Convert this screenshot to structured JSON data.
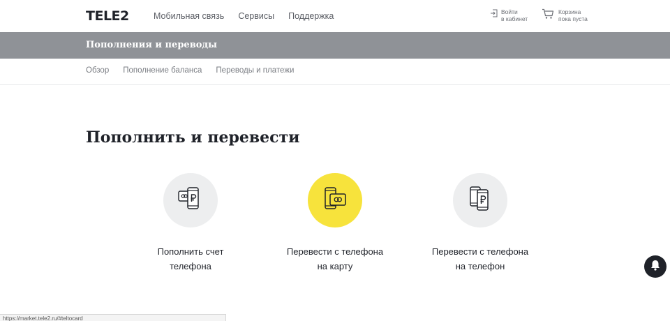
{
  "header": {
    "logo": "TELE2",
    "nav": [
      "Мобильная связь",
      "Сервисы",
      "Поддержка"
    ],
    "login": {
      "line1": "Войти",
      "line2": "в кабинет",
      "icon": "login-icon"
    },
    "cart": {
      "line1": "Корзина",
      "line2": "пока пуста",
      "icon": "cart-icon"
    }
  },
  "band": {
    "title": "Пополнения и переводы"
  },
  "subnav": [
    "Обзор",
    "Пополнение баланса",
    "Переводы и платежи"
  ],
  "main": {
    "heading": "Пополнить и перевести",
    "cards": [
      {
        "line1": "Пополнить счет",
        "line2": "телефона",
        "icon": "phone-card-ruble-icon",
        "circle_color": "#edeeef"
      },
      {
        "line1": "Перевести с телефона",
        "line2": "на карту",
        "icon": "phone-to-card-icon",
        "circle_color": "#f7e33c"
      },
      {
        "line1": "Перевести с телефона",
        "line2": "на телефон",
        "icon": "phone-to-phone-icon",
        "circle_color": "#edeeef"
      }
    ]
  },
  "status_url": "https://market.tele2.ru/#teltocard",
  "colors": {
    "accent_yellow": "#f7e33c",
    "band_gray": "#8f9297",
    "text_dark": "#1f2229"
  }
}
